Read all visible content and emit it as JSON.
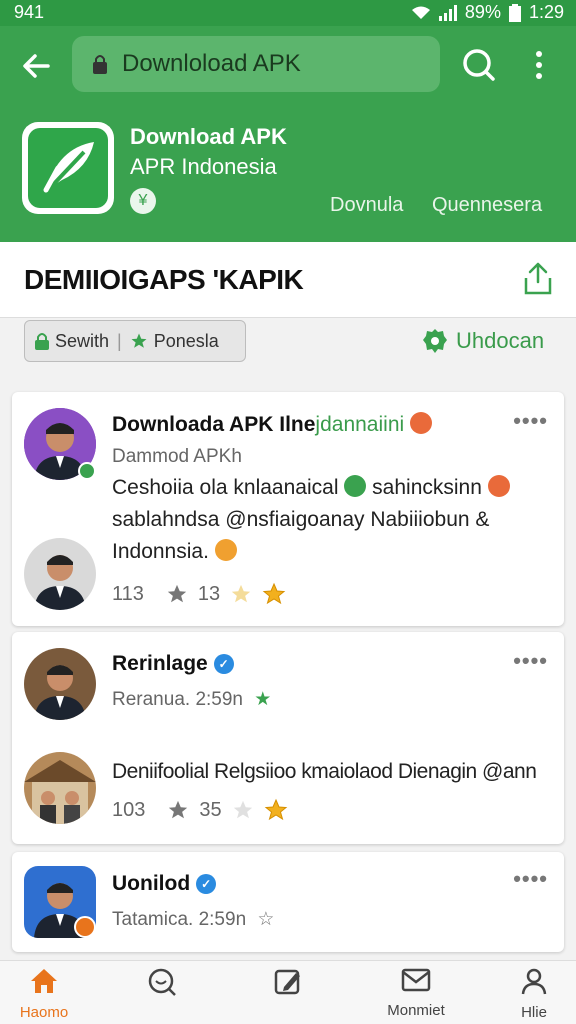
{
  "status_bar": {
    "time_left": "941",
    "battery": "89%",
    "clock": "1:29"
  },
  "toolbar": {
    "url": "Downloload APK"
  },
  "app": {
    "title": "Download APK",
    "subtitle": "APR  Indonesia",
    "badge": "¥",
    "link1": "Dovnula",
    "link2": "Quennesera"
  },
  "section": {
    "title": "DEMIIOIGAPS 'KAPIK"
  },
  "filters": {
    "item1": "Sewith",
    "item2": "Ponesla"
  },
  "download_link": "Uhdocan",
  "cards": [
    {
      "name": "Downloada APK Ilne",
      "name_highlight": "jdannaiini",
      "meta": "Dammod APKh",
      "body_lines": [
        "Ceshoiia ola knlaanaical",
        "sahincksinn",
        "sablahndsa @nsfiaigoanay Nabiiiobun &",
        "Indonnsia."
      ],
      "stats": {
        "count": "113",
        "stars": "13"
      }
    },
    {
      "name": "Rerinlage",
      "meta": "Reranua. 2:59n",
      "body": "Deniifoolial Relgsiioo kmaiolaod Dienagin @ann",
      "stats": {
        "count": "103",
        "stars": "35"
      }
    },
    {
      "name": "Uonilod",
      "meta": "Tatamica. 2:59n"
    }
  ],
  "bottom_nav": [
    {
      "label": "Haomo",
      "icon": "home-icon"
    },
    {
      "label": "",
      "icon": "search-icon"
    },
    {
      "label": "",
      "icon": "edit-icon"
    },
    {
      "label": "Monmiet",
      "icon": "mail-icon"
    },
    {
      "label": "Hlie",
      "icon": "profile-icon"
    }
  ],
  "colors": {
    "brand_green": "#3aa24f",
    "accent_orange": "#e8741c"
  }
}
